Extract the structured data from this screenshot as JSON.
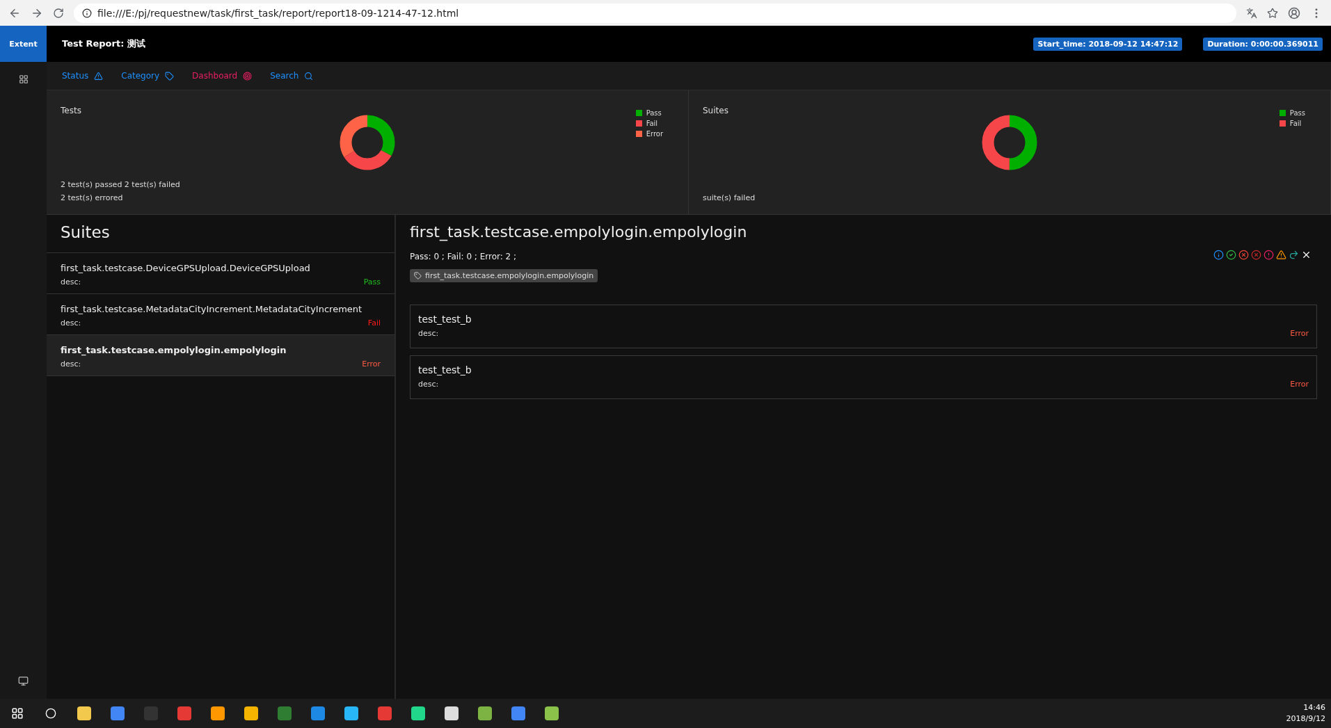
{
  "browser": {
    "url": "file:///E:/pj/requestnew/task/first_task/report/report18-09-1214-47-12.html"
  },
  "header": {
    "brand": "Extent",
    "title": "Test Report: 测试",
    "start_time": "Start_time: 2018-09-12 14:47:12",
    "duration": "Duration: 0:00:00.369011"
  },
  "nav": [
    {
      "label": "Status",
      "color": "#1e90ff"
    },
    {
      "label": "Category",
      "color": "#1e90ff"
    },
    {
      "label": "Dashboard",
      "color": "#e91e63"
    },
    {
      "label": "Search",
      "color": "#1e90ff"
    }
  ],
  "dashboard": [
    {
      "title": "Tests",
      "legend": [
        {
          "label": "Pass",
          "color": "#00af00"
        },
        {
          "label": "Fail",
          "color": "#f7464a"
        },
        {
          "label": "Error",
          "color": "#ff6347"
        }
      ],
      "summary": [
        "2 test(s) passed 2 test(s) failed",
        "2 test(s) errored"
      ]
    },
    {
      "title": "Suites",
      "legend": [
        {
          "label": "Pass",
          "color": "#00af00"
        },
        {
          "label": "Fail",
          "color": "#f7464a"
        }
      ],
      "summary": [
        "suite(s) failed"
      ]
    }
  ],
  "suites": {
    "title": "Suites",
    "items": [
      {
        "name": "first_task.testcase.DeviceGPSUpload.DeviceGPSUpload",
        "desc": "desc:",
        "status": "Pass",
        "kind": "pass",
        "selected": false
      },
      {
        "name": "first_task.testcase.MetadataCityIncrement.MetadataCityIncrement",
        "desc": "desc:",
        "status": "Fail",
        "kind": "fail",
        "selected": false
      },
      {
        "name": "first_task.testcase.empolylogin.empolylogin",
        "desc": "desc:",
        "status": "Error",
        "kind": "error",
        "selected": true
      }
    ]
  },
  "detail": {
    "title": "first_task.testcase.empolylogin.empolylogin",
    "counts": "Pass: 0 ; Fail: 0 ; Error: 2 ;",
    "tag": "first_task.testcase.empolylogin.empolylogin",
    "tests": [
      {
        "name": "test_test_b",
        "desc": "desc:",
        "status": "Error",
        "kind": "error"
      },
      {
        "name": "test_test_b",
        "desc": "desc:",
        "status": "Error",
        "kind": "error"
      }
    ]
  },
  "taskbar": {
    "time": "14:46",
    "date": "2018/9/12"
  }
}
